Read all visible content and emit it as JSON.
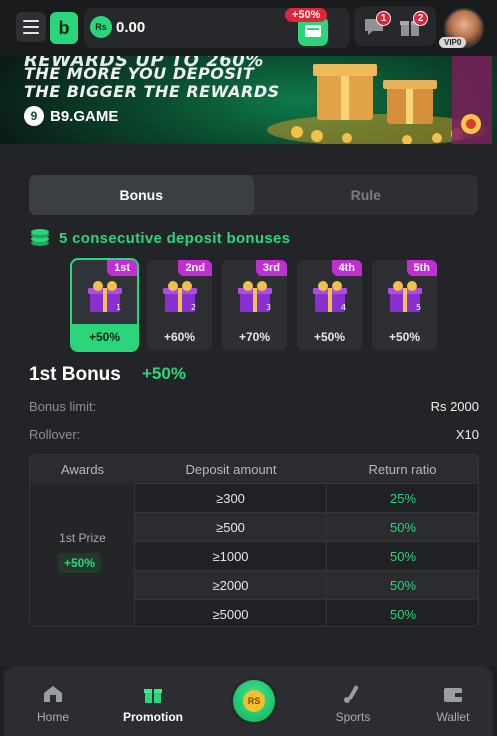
{
  "header": {
    "balance": "0.00",
    "currency_symbol": "Rs",
    "deposit_badge": "+50%",
    "message_count": "1",
    "gift_count": "2",
    "vip_label": "VIP0",
    "logo_letter": "b"
  },
  "banner": {
    "line1": "REWARDS UP TO 260%",
    "line2": "THE MORE YOU DEPOSIT",
    "line3": "THE BIGGER THE REWARDS",
    "brand": "B9.GAME"
  },
  "tabs": [
    {
      "label": "Bonus",
      "active": true
    },
    {
      "label": "Rule",
      "active": false
    }
  ],
  "bonus_heading": "5 consecutive deposit bonuses",
  "cards": [
    {
      "tag": "1st",
      "pct": "+50%",
      "num": "1",
      "active": true
    },
    {
      "tag": "2nd",
      "pct": "+60%",
      "num": "2",
      "active": false
    },
    {
      "tag": "3rd",
      "pct": "+70%",
      "num": "3",
      "active": false
    },
    {
      "tag": "4th",
      "pct": "+50%",
      "num": "4",
      "active": false
    },
    {
      "tag": "5th",
      "pct": "+50%",
      "num": "5",
      "active": false
    }
  ],
  "selected_bonus": {
    "title": "1st Bonus",
    "pct": "+50%",
    "limit_label": "Bonus limit:",
    "limit_value": "Rs 2000",
    "rollover_label": "Rollover:",
    "rollover_value": "X10"
  },
  "table": {
    "headers": [
      "Awards",
      "Deposit amount",
      "Return ratio"
    ],
    "prize_name": "1st Prize",
    "prize_pct": "+50%",
    "rows": [
      {
        "deposit": "≥300",
        "ratio": "25%"
      },
      {
        "deposit": "≥500",
        "ratio": "50%"
      },
      {
        "deposit": "≥1000",
        "ratio": "50%"
      },
      {
        "deposit": "≥2000",
        "ratio": "50%"
      },
      {
        "deposit": "≥5000",
        "ratio": "50%"
      }
    ]
  },
  "nav": {
    "home": "Home",
    "promotion": "Promotion",
    "center_coin": "RS",
    "sports": "Sports",
    "wallet": "Wallet"
  },
  "colors": {
    "accent": "#2bd67b",
    "badge": "#e0243a",
    "tag": "#c02fd4"
  }
}
